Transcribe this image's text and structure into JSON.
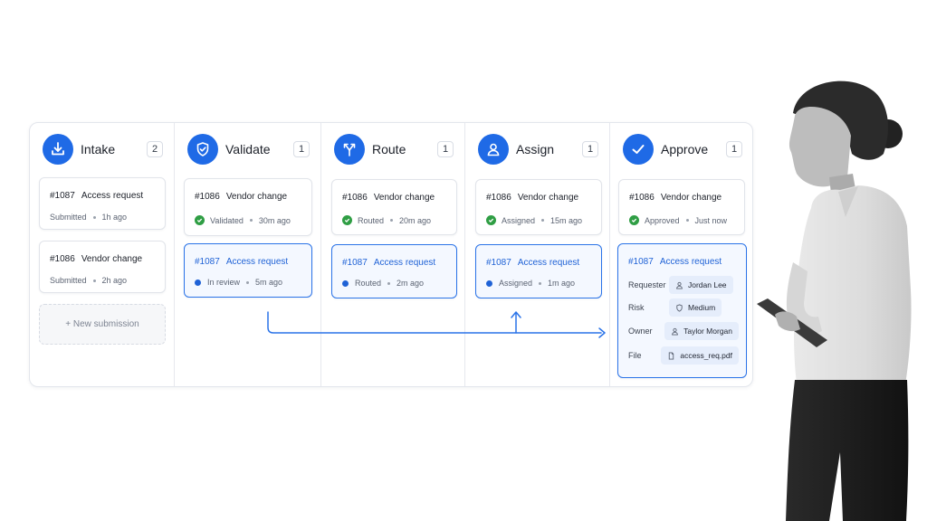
{
  "columns": [
    {
      "title": "Intake",
      "count": "2",
      "icon": "download-icon",
      "cards": [
        {
          "id": "#1087",
          "title": "Access request",
          "status": "Submitted",
          "time": "1h ago"
        },
        {
          "id": "#1086",
          "title": "Vendor change",
          "status": "Submitted",
          "time": "2h ago"
        }
      ],
      "new_submission_label": "+ New submission"
    },
    {
      "title": "Validate",
      "count": "1",
      "icon": "shield-check-icon",
      "cards": [
        {
          "id": "#1086",
          "title": "Vendor change",
          "status": "Validated",
          "time": "30m ago"
        },
        {
          "id": "#1087",
          "title": "Access request",
          "status": "In review",
          "time": "5m ago"
        }
      ]
    },
    {
      "title": "Route",
      "count": "1",
      "icon": "route-split-icon",
      "cards": [
        {
          "id": "#1086",
          "title": "Vendor change",
          "status": "Routed",
          "time": "20m ago"
        },
        {
          "id": "#1087",
          "title": "Access request",
          "status": "Routed",
          "time": "2m ago"
        }
      ]
    },
    {
      "title": "Assign",
      "count": "1",
      "icon": "user-icon",
      "cards": [
        {
          "id": "#1086",
          "title": "Vendor change",
          "status": "Assigned",
          "time": "15m ago"
        },
        {
          "id": "#1087",
          "title": "Access request",
          "status": "Assigned",
          "time": "1m ago"
        }
      ]
    },
    {
      "title": "Approve",
      "count": "1",
      "icon": "checkmark-icon",
      "cards": [
        {
          "id": "#1086",
          "title": "Vendor change",
          "status": "Approved",
          "time": "Just now"
        }
      ],
      "detail": {
        "id": "#1087",
        "title": "Access request",
        "fields": [
          {
            "label": "Requester",
            "value": "Jordan Lee",
            "icon": "person-icon"
          },
          {
            "label": "Risk",
            "value": "Medium",
            "icon": "shield-icon"
          },
          {
            "label": "Owner",
            "value": "Taylor Morgan",
            "icon": "person-icon"
          },
          {
            "label": "File",
            "value": "access_req.pdf",
            "icon": "document-icon"
          }
        ]
      }
    }
  ],
  "colors": {
    "accent": "#1f6ae6",
    "success": "#2f9e44",
    "selected_bg": "#f4f8ff"
  }
}
